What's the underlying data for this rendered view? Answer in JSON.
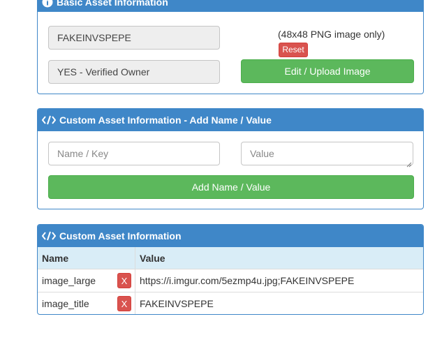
{
  "basic": {
    "title": "Basic Asset Information",
    "asset_name": "FAKEINVSPEPE",
    "owner_status": "YES - Verified Owner",
    "image_note": "(48x48 PNG image only)",
    "reset_label": "Reset",
    "upload_label": "Edit / Upload Image"
  },
  "add_custom": {
    "title": "Custom Asset Information - Add Name / Value",
    "name_placeholder": "Name / Key",
    "value_placeholder": "Value",
    "add_label": "Add Name / Value"
  },
  "custom": {
    "title": "Custom Asset Information",
    "headers": {
      "name": "Name",
      "value": "Value"
    },
    "rows": [
      {
        "name": "image_large",
        "delete_label": "X",
        "value": "https://i.imgur.com/5ezmp4u.jpg;FAKEINVSPEPE"
      },
      {
        "name": "image_title",
        "delete_label": "X",
        "value": "FAKEINVSPEPE"
      }
    ]
  },
  "colors": {
    "panel_header": "#3f87c8",
    "success": "#5cb85c",
    "danger": "#d9534f",
    "table_header": "#d9edf7"
  },
  "icons": {
    "basic": "info-circle-icon",
    "custom": "code-icon"
  }
}
